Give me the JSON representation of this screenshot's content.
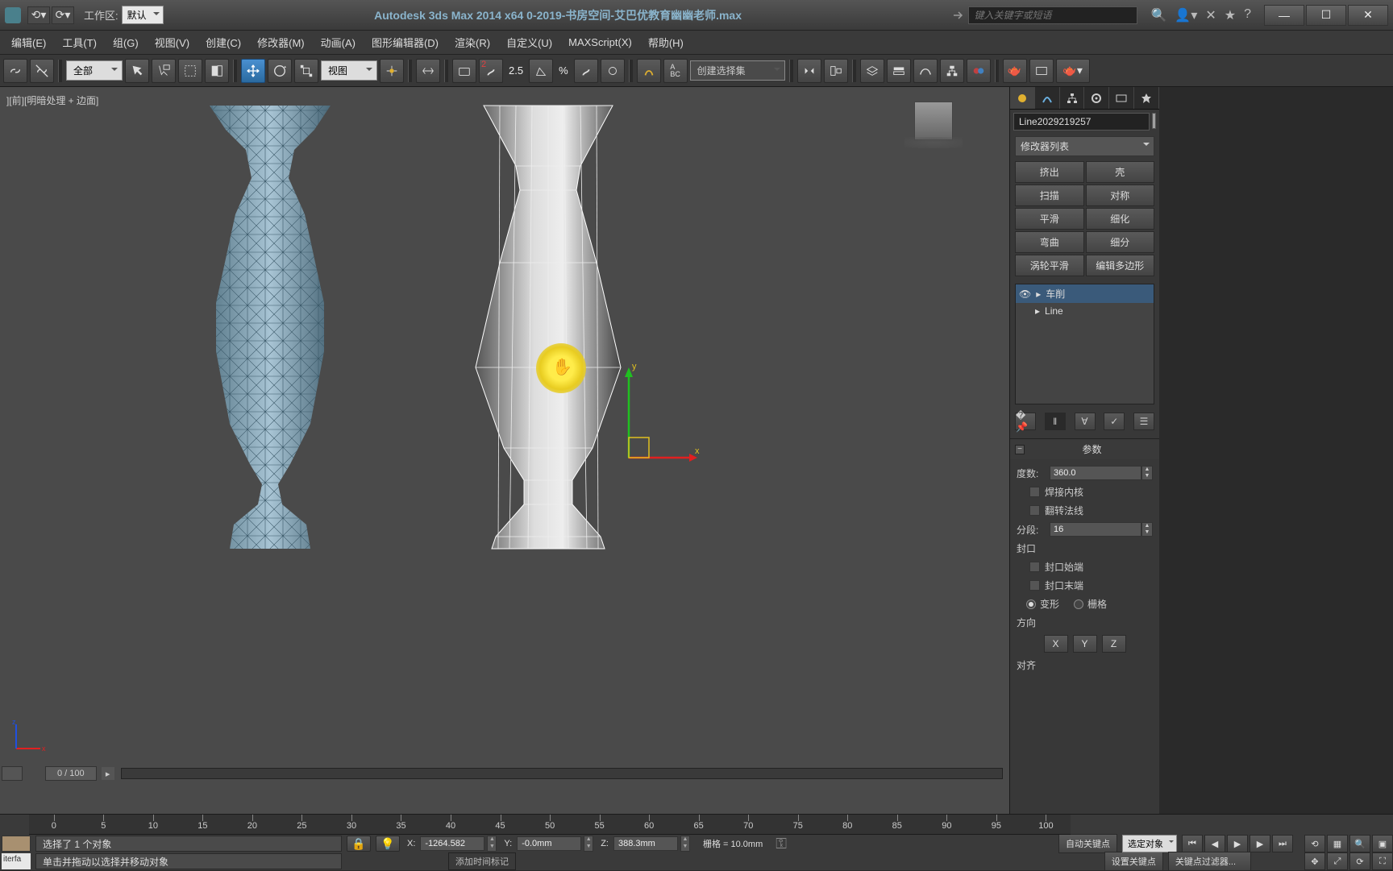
{
  "titlebar": {
    "workspace_label": "工作区: ",
    "workspace_value": "默认",
    "title": "Autodesk 3ds Max  2014 x64      0-2019-书房空间-艾巴优教育幽幽老师.max",
    "search_placeholder": "键入关键字或短语"
  },
  "menu": [
    "编辑(E)",
    "工具(T)",
    "组(G)",
    "视图(V)",
    "创建(C)",
    "修改器(M)",
    "动画(A)",
    "图形编辑器(D)",
    "渲染(R)",
    "自定义(U)",
    "MAXScript(X)",
    "帮助(H)"
  ],
  "toolbar": {
    "sel_filter": "全部",
    "view_dd": "视图",
    "snap_angle": "2.5",
    "snap_pct": "%",
    "named_sel": "创建选择集"
  },
  "viewport": {
    "label": "][前][明暗处理 + 边面]",
    "axis_x": "x",
    "axis_y": "y",
    "axis_z": "z",
    "timeline": "0 / 100"
  },
  "panel": {
    "object_name": "Line2029219257",
    "modifier_list": "修改器列表",
    "buttons": [
      "挤出",
      "壳",
      "扫描",
      "对称",
      "平滑",
      "细化",
      "弯曲",
      "细分",
      "涡轮平滑",
      "编辑多边形"
    ],
    "stack": [
      "车削",
      "Line"
    ],
    "params_title": "参数",
    "degrees_label": "度数:",
    "degrees_value": "360.0",
    "weld_core": "焊接内核",
    "flip_normals": "翻转法线",
    "segments_label": "分段:",
    "segments_value": "16",
    "capping": "封口",
    "cap_start": "封口始端",
    "cap_end": "封口末端",
    "morph": "变形",
    "grid": "栅格",
    "direction": "方向",
    "axis_x": "X",
    "axis_y": "Y",
    "axis_z": "Z",
    "align": "对齐"
  },
  "ruler": [
    "0",
    "5",
    "10",
    "15",
    "20",
    "25",
    "30",
    "35",
    "40",
    "45",
    "50",
    "55",
    "60",
    "65",
    "70",
    "75",
    "80",
    "85",
    "90",
    "95",
    "100"
  ],
  "status": {
    "line1": "选择了 1 个对象",
    "line2": "单击并拖动以选择并移动对象",
    "x_label": "X:",
    "x_val": "-1264.582",
    "y_label": "Y:",
    "y_val": "-0.0mm",
    "z_label": "Z:",
    "z_val": "388.3mm",
    "grid": "栅格 = 10.0mm",
    "auto_key": "自动关键点",
    "set_key": "设置关键点",
    "sel_obj": "选定对象",
    "key_filter": "关键点过滤器...",
    "add_time_tag": "添加时间标记",
    "interfa": "iterfa"
  }
}
